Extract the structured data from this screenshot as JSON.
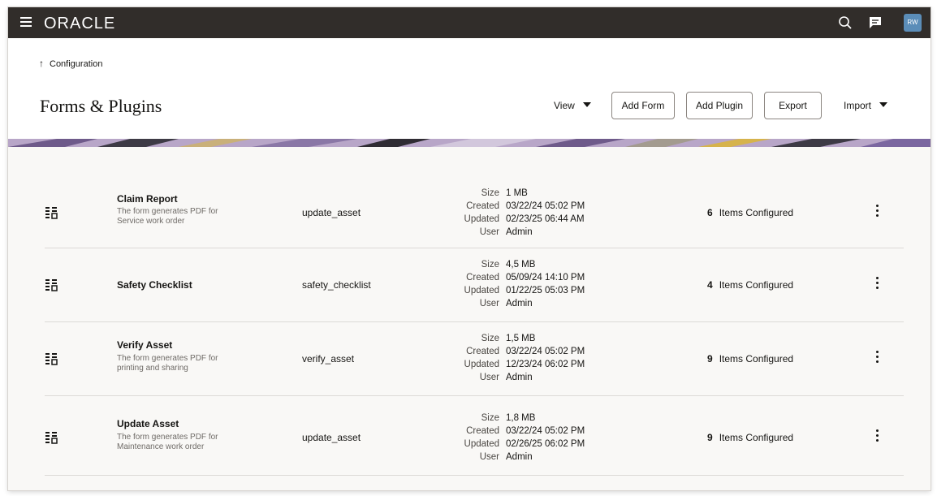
{
  "header": {
    "logo": "ORACLE",
    "avatar_initials": "RW",
    "bar_color": "#312d2a",
    "avatar_color": "#5b8db8"
  },
  "breadcrumb": {
    "label": "Configuration"
  },
  "page": {
    "title": "Forms & Plugins"
  },
  "toolbar": {
    "view_label": "View",
    "add_form_label": "Add Form",
    "add_plugin_label": "Add Plugin",
    "export_label": "Export",
    "import_label": "Import"
  },
  "meta_labels": {
    "size": "Size",
    "created": "Created",
    "updated": "Updated",
    "user": "User"
  },
  "items_configured_label": "Items Configured",
  "rows": [
    {
      "name": "Claim Report",
      "description": "The form generates PDF for Service work order",
      "code": "update_asset",
      "size": "1 MB",
      "created": "03/22/24 05:02 PM",
      "updated": "02/23/25 06:44 AM",
      "user": "Admin",
      "count": "6"
    },
    {
      "name": "Safety Checklist",
      "description": "",
      "code": "safety_checklist",
      "size": "4,5 MB",
      "created": "05/09/24 14:10 PM",
      "updated": "01/22/25 05:03 PM",
      "user": "Admin",
      "count": "4"
    },
    {
      "name": "Verify Asset",
      "description": "The form generates PDF for printing and sharing",
      "code": "verify_asset",
      "size": "1,5 MB",
      "created": "03/22/24 05:02 PM",
      "updated": "12/23/24 06:02 PM",
      "user": "Admin",
      "count": "9"
    },
    {
      "name": "Update Asset",
      "description": "The form generates PDF for Maintenance work order",
      "code": "update_asset",
      "size": "1,8 MB",
      "created": "03/22/24 05:02 PM",
      "updated": "02/26/25 06:02 PM",
      "user": "Admin",
      "count": "9"
    }
  ],
  "icons": {
    "menu": "hamburger-icon",
    "search": "search-icon",
    "chat": "chat-icon",
    "row": "form-template-icon",
    "actions": "kebab-menu-icon"
  }
}
